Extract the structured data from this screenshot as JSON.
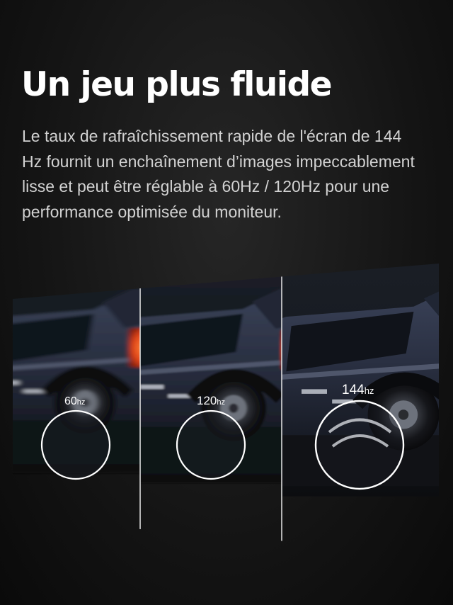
{
  "headline": "Un jeu plus fluide",
  "description": "Le taux de rafraîchissement rapide de l'écran de 144 Hz fournit un enchaînement d’images impeccablement lisse et peut être réglable à 60Hz / 120Hz pour une performance optimisée du moniteur.",
  "panels": [
    {
      "number": "60",
      "unit": "hz"
    },
    {
      "number": "120",
      "unit": "hz"
    },
    {
      "number": "144",
      "unit": "hz"
    }
  ],
  "colors": {
    "background": "#141414",
    "text": "#ffffff",
    "body_text": "#d2d2d2",
    "car_body": "#2e3548",
    "tail_light": "#ff5a1e"
  }
}
